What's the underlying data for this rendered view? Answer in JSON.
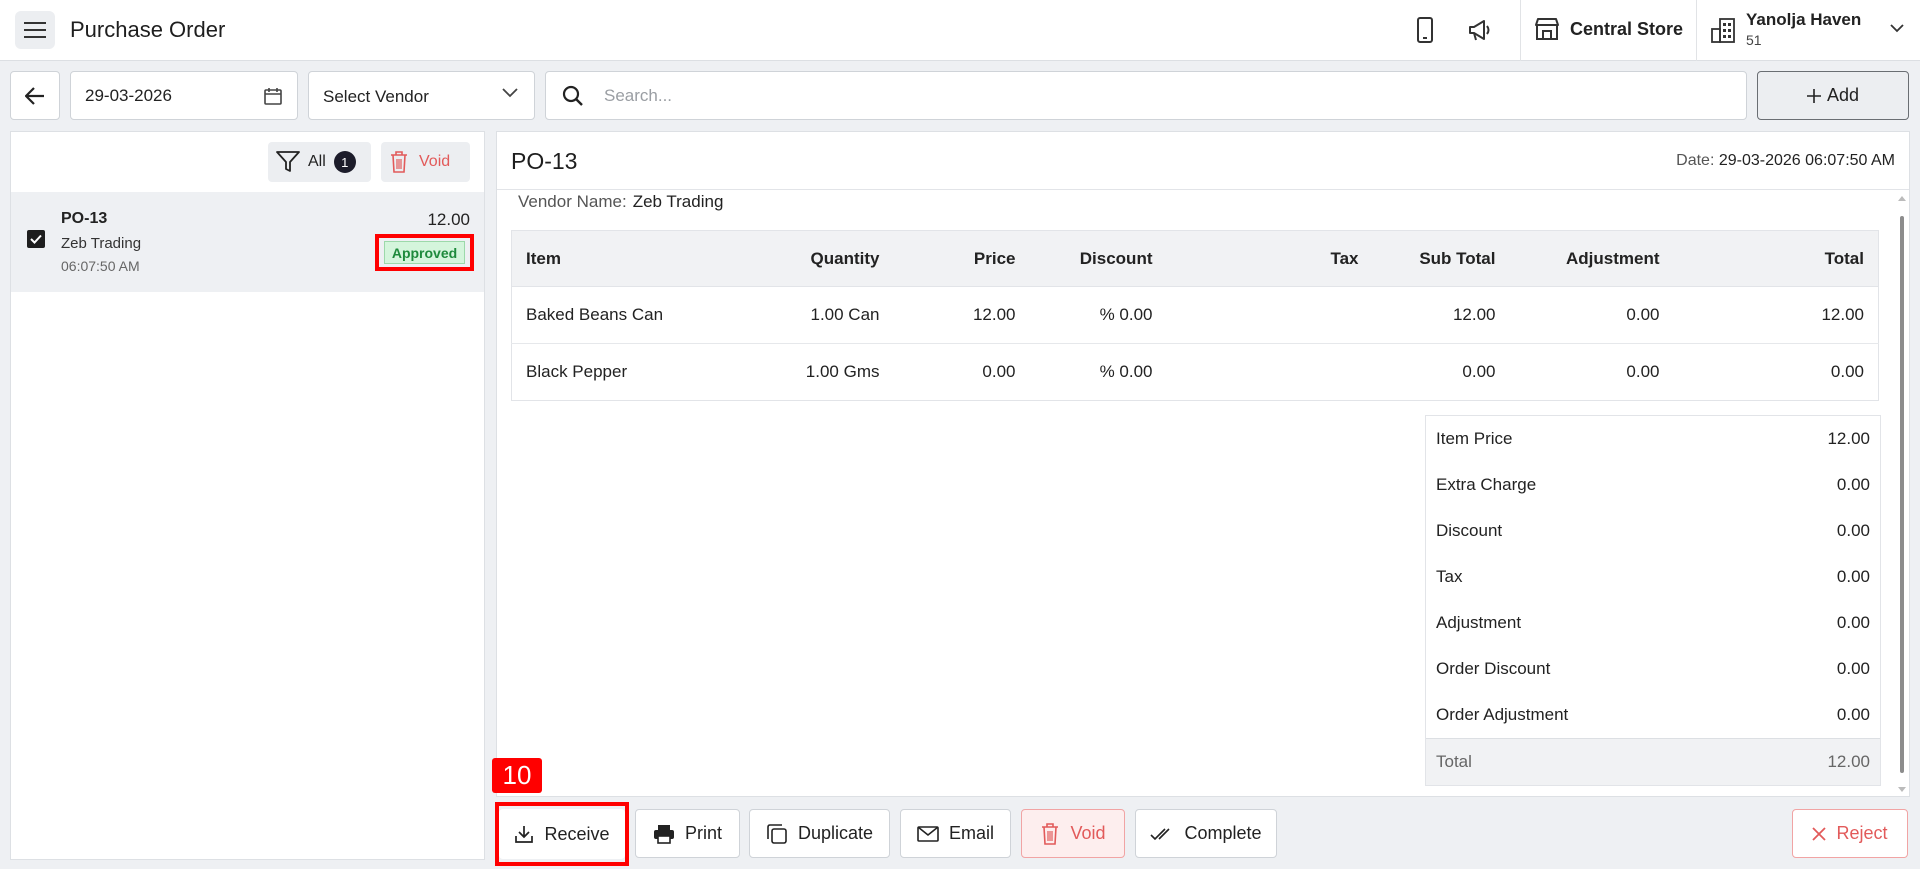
{
  "header": {
    "title": "Purchase Order",
    "store": "Central Store",
    "hotel_name": "Yanolja Haven",
    "hotel_sub": "51"
  },
  "filters": {
    "date": "29-03-2026",
    "vendor_placeholder": "Select Vendor",
    "search_placeholder": "Search...",
    "add_label": "Add"
  },
  "list_toolbar": {
    "filter_label": "All",
    "filter_count": "1",
    "void_label": "Void"
  },
  "orders": [
    {
      "id": "PO-13",
      "vendor": "Zeb Trading",
      "time": "06:07:50 AM",
      "amount": "12.00",
      "status": "Approved"
    }
  ],
  "detail": {
    "title": "PO-13",
    "date_label": "Date:",
    "date_value": "29-03-2026 06:07:50 AM",
    "vendor_label": "Vendor Name:",
    "vendor_value": "Zeb Trading",
    "columns": [
      "Item",
      "Quantity",
      "Price",
      "Discount",
      "Tax",
      "Sub Total",
      "Adjustment",
      "Total"
    ],
    "rows": [
      [
        "Baked Beans Can",
        "1.00 Can",
        "12.00",
        "% 0.00",
        "",
        "12.00",
        "0.00",
        "12.00"
      ],
      [
        "Black Pepper",
        "1.00 Gms",
        "0.00",
        "% 0.00",
        "",
        "0.00",
        "0.00",
        "0.00"
      ]
    ],
    "summary": [
      {
        "label": "Item Price",
        "value": "12.00"
      },
      {
        "label": "Extra Charge",
        "value": "0.00"
      },
      {
        "label": "Discount",
        "value": "0.00"
      },
      {
        "label": "Tax",
        "value": "0.00"
      },
      {
        "label": "Adjustment",
        "value": "0.00"
      },
      {
        "label": "Order Discount",
        "value": "0.00"
      },
      {
        "label": "Order Adjustment",
        "value": "0.00"
      }
    ],
    "total": {
      "label": "Total",
      "value": "12.00"
    }
  },
  "actions": {
    "receive": "Receive",
    "print": "Print",
    "duplicate": "Duplicate",
    "email": "Email",
    "void": "Void",
    "complete": "Complete",
    "reject": "Reject"
  },
  "annotation_marker": "10",
  "colors": {
    "highlight": "#ff0000",
    "danger": "#e25a5a",
    "approved_bg": "#d4f5dc",
    "approved_text": "#1e8a3c"
  }
}
